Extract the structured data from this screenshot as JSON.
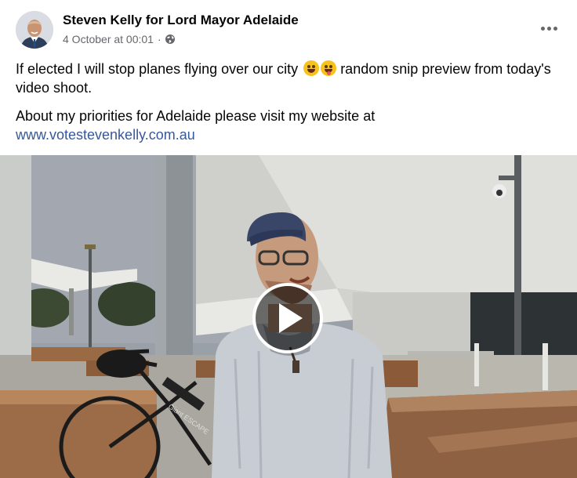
{
  "post": {
    "author": "Steven Kelly for Lord Mayor Adelaide",
    "timestamp": "4 October at 00:01",
    "separator": "·",
    "privacy_icon": "globe-icon",
    "more_icon": "more-options-icon",
    "text_line1": "If elected I will stop planes flying over our city",
    "emojis": [
      "grinning-sweat-emoji",
      "winking-tongue-emoji"
    ],
    "text_line1_rest": " random snip preview from today's video shoot.",
    "text_line2": "About my priorities for Adelaide please visit my website at",
    "link": "www.votestevenkelly.com.au",
    "bike_label": "Giant ESCAPE",
    "video_icon": "play-icon",
    "colors": {
      "link": "#385898",
      "secondary_text": "#65676b",
      "primary_text": "#050505"
    }
  }
}
